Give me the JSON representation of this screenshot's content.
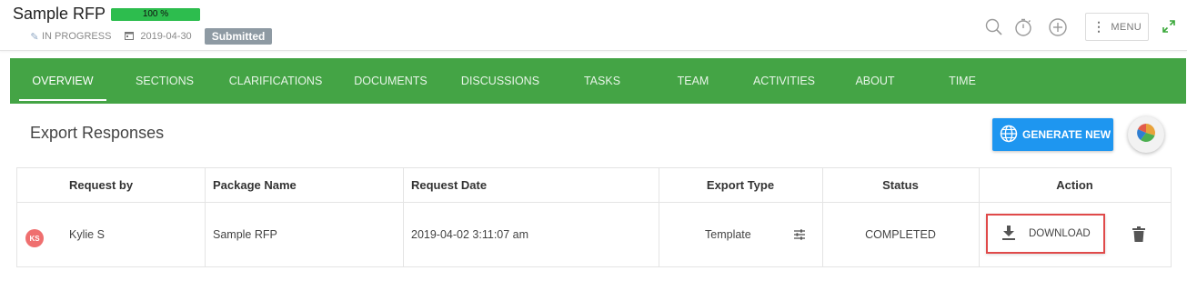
{
  "header": {
    "title": "Sample RFP",
    "progress_label": "100 %",
    "progress_value": 100,
    "state_label": "IN PROGRESS",
    "date": "2019-04-30",
    "status_badge": "Submitted",
    "menu_label": "MENU",
    "icons": [
      "search-icon",
      "timer-icon",
      "add-icon",
      "more-vert-icon",
      "expand-icon"
    ]
  },
  "nav": {
    "tabs": [
      {
        "label": "OVERVIEW",
        "active": true
      },
      {
        "label": "SECTIONS",
        "active": false
      },
      {
        "label": "CLARIFICATIONS",
        "active": false
      },
      {
        "label": "DOCUMENTS",
        "active": false
      },
      {
        "label": "DISCUSSIONS",
        "active": false
      },
      {
        "label": "TASKS",
        "active": false
      },
      {
        "label": "TEAM",
        "active": false
      },
      {
        "label": "ACTIVITIES",
        "active": false
      },
      {
        "label": "ABOUT",
        "active": false
      },
      {
        "label": "TIME",
        "active": false
      }
    ]
  },
  "main": {
    "section_title": "Export Responses",
    "generate_label": "GENERATE NEW",
    "table": {
      "columns": [
        "Request by",
        "Package Name",
        "Request Date",
        "Export Type",
        "Status",
        "Action"
      ],
      "rows": [
        {
          "avatar_initials": "KS",
          "request_by": "Kylie S",
          "package_name": "Sample RFP",
          "request_date": "2019-04-02 3:11:07 am",
          "export_type": "Template",
          "status": "COMPLETED",
          "action_label": "DOWNLOAD"
        }
      ]
    }
  },
  "colors": {
    "nav_bg": "#44a445",
    "progress": "#2dbd4e",
    "primary_button": "#1e96f0",
    "badge": "#8e9aa3",
    "avatar": "#ef6f6f",
    "highlight": "#e04a4a"
  }
}
